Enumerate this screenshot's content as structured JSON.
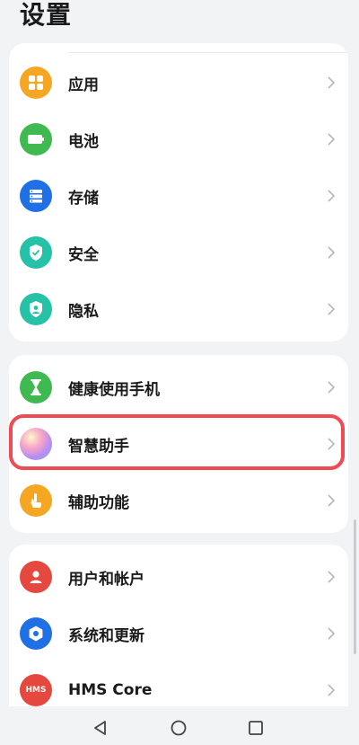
{
  "header": {
    "title": "设置"
  },
  "groups": [
    {
      "items": [
        {
          "label": "应用",
          "icon": "apps-icon",
          "color": "#f5a623"
        },
        {
          "label": "电池",
          "icon": "battery-icon",
          "color": "#3fb950"
        },
        {
          "label": "存储",
          "icon": "storage-icon",
          "color": "#1f6fe5"
        },
        {
          "label": "安全",
          "icon": "shield-icon",
          "color": "#25c2a8"
        },
        {
          "label": "隐私",
          "icon": "privacy-icon",
          "color": "#25c2a8"
        }
      ]
    },
    {
      "items": [
        {
          "label": "健康使用手机",
          "icon": "hourglass-icon",
          "color": "#3fb950"
        },
        {
          "label": "智慧助手",
          "icon": "assistant-icon",
          "color": "#c67de8"
        },
        {
          "label": "辅助功能",
          "icon": "hand-icon",
          "color": "#f5a623"
        }
      ]
    },
    {
      "items": [
        {
          "label": "用户和帐户",
          "icon": "user-icon",
          "color": "#e5483f"
        },
        {
          "label": "系统和更新",
          "icon": "settings-icon",
          "color": "#1f6fe5"
        },
        {
          "label": "HMS Core",
          "icon": "hms-icon",
          "color": "#e5483f",
          "icon_text": "HMS"
        }
      ]
    }
  ],
  "highlight_color": "#ef4b55",
  "navbar": {
    "back": "back-triangle-icon",
    "home": "home-circle-icon",
    "recent": "recent-square-icon"
  }
}
